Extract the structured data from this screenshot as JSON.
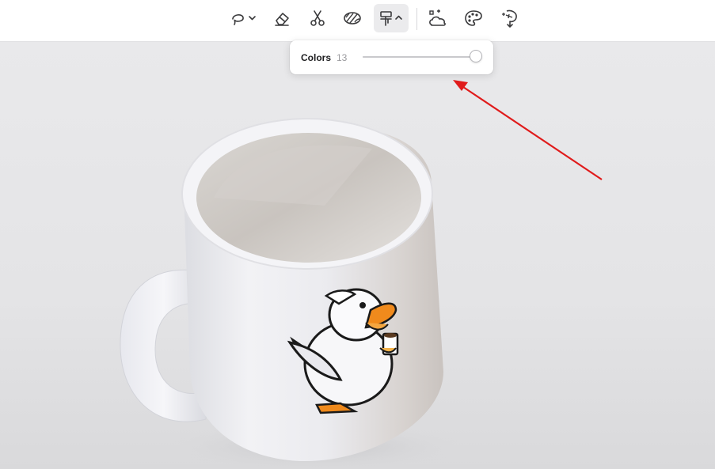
{
  "toolbar": {
    "tools": [
      {
        "icon": "lasso-icon",
        "menu": "chevron-down"
      },
      {
        "icon": "eraser-icon"
      },
      {
        "icon": "scissors-icon"
      },
      {
        "icon": "pattern-icon"
      },
      {
        "icon": "paint-roller-icon",
        "menu": "chevron-up",
        "active": true
      },
      {
        "icon": "cloud-select-icon"
      },
      {
        "icon": "palette-icon"
      },
      {
        "icon": "magic-wand-icon"
      }
    ]
  },
  "popover": {
    "label": "Colors",
    "value": "13",
    "slider_level": 0.98
  },
  "annotation": {
    "arrow_color": "#e01b1b"
  }
}
